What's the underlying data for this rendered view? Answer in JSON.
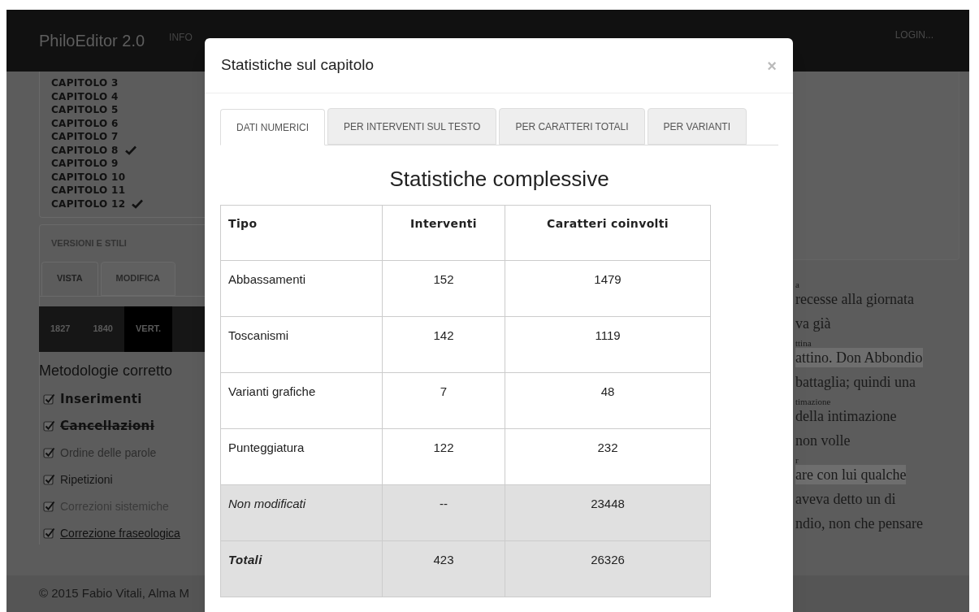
{
  "navbar": {
    "brand": "PhiloEditor 2.0",
    "links": [
      "INFO"
    ],
    "login": "LOGIN..."
  },
  "chapters": [
    {
      "label": "CAPITOLO 3",
      "checked": false
    },
    {
      "label": "CAPITOLO 4",
      "checked": false
    },
    {
      "label": "CAPITOLO 5",
      "checked": false
    },
    {
      "label": "CAPITOLO 6",
      "checked": false
    },
    {
      "label": "CAPITOLO 7",
      "checked": false
    },
    {
      "label": "CAPITOLO 8",
      "checked": true
    },
    {
      "label": "CAPITOLO 9",
      "checked": false
    },
    {
      "label": "CAPITOLO 10",
      "checked": false
    },
    {
      "label": "CAPITOLO 11",
      "checked": false
    },
    {
      "label": "CAPITOLO 12",
      "checked": true
    }
  ],
  "versions_panel": {
    "title": "VERSIONI E STILI",
    "tabs": [
      {
        "label": "VISTA",
        "selected": true
      },
      {
        "label": "MODIFICA",
        "selected": false
      }
    ],
    "versions": [
      {
        "label": "1827",
        "selected": false
      },
      {
        "label": "1840",
        "selected": false
      },
      {
        "label": "VERT.",
        "selected": true
      }
    ]
  },
  "methods": {
    "title": "Metodologie corretto",
    "items": [
      {
        "label": "Inserimenti",
        "kind": "bold",
        "checked": true
      },
      {
        "label": "Cancellazioni",
        "kind": "struck",
        "checked": true
      },
      {
        "label": "Ordine delle parole",
        "kind": "light",
        "checked": true
      },
      {
        "label": "Ripetizioni",
        "kind": "plain",
        "checked": true
      },
      {
        "label": "Correzioni sistemiche",
        "kind": "faint",
        "checked": true
      },
      {
        "label": "Correzione fraseologica",
        "kind": "underlined",
        "checked": true
      }
    ]
  },
  "footer": "© 2015 Fabio Vitali, Alma M",
  "text_lines": [
    {
      "text": "a",
      "kind": "annotation"
    },
    {
      "text": "recesse alla giornata",
      "kind": "line",
      "highlighted": false
    },
    {
      "text": "va già",
      "kind": "line",
      "highlighted": false
    },
    {
      "text": "ttina",
      "kind": "annotation"
    },
    {
      "text": "attino. Don Abbondio",
      "kind": "line",
      "highlighted": true
    },
    {
      "text": "battaglia; quindi una",
      "kind": "line",
      "highlighted": false
    },
    {
      "text": "timazione",
      "kind": "annotation"
    },
    {
      "text": "della intimazione",
      "kind": "line",
      "highlighted": false
    },
    {
      "text": "non volle",
      "kind": "line",
      "highlighted": false
    },
    {
      "text": "r",
      "kind": "annotation"
    },
    {
      "text": "are con lui qualche",
      "kind": "line",
      "highlighted": true
    },
    {
      "text": "aveva detto un di",
      "kind": "line",
      "highlighted": false
    },
    {
      "text": "ndio, non che pensare",
      "kind": "line",
      "highlighted": false
    }
  ],
  "modal": {
    "title": "Statistiche sul capitolo",
    "close": "×",
    "tabs": [
      {
        "label": "DATI NUMERICI",
        "selected": true
      },
      {
        "label": "PER INTERVENTI SUL TESTO",
        "selected": false
      },
      {
        "label": "PER CARATTERI TOTALI",
        "selected": false
      },
      {
        "label": "PER VARIANTI",
        "selected": false
      }
    ],
    "heading": "Statistiche complessive",
    "table": {
      "columns": [
        "Tipo",
        "Interventi",
        "Caratteri coinvolti"
      ],
      "rows": [
        {
          "kind": "normal",
          "cells": [
            "Abbassamenti",
            "152",
            "1479"
          ]
        },
        {
          "kind": "normal",
          "cells": [
            "Toscanismi",
            "142",
            "1119"
          ]
        },
        {
          "kind": "normal",
          "cells": [
            "Varianti grafiche",
            "7",
            "48"
          ]
        },
        {
          "kind": "normal",
          "cells": [
            "Punteggiatura",
            "122",
            "232"
          ]
        },
        {
          "kind": "unchanged",
          "cells": [
            "Non modificati",
            "--",
            "23448"
          ]
        },
        {
          "kind": "total",
          "cells": [
            "Totali",
            "423",
            "26326"
          ]
        }
      ]
    }
  }
}
